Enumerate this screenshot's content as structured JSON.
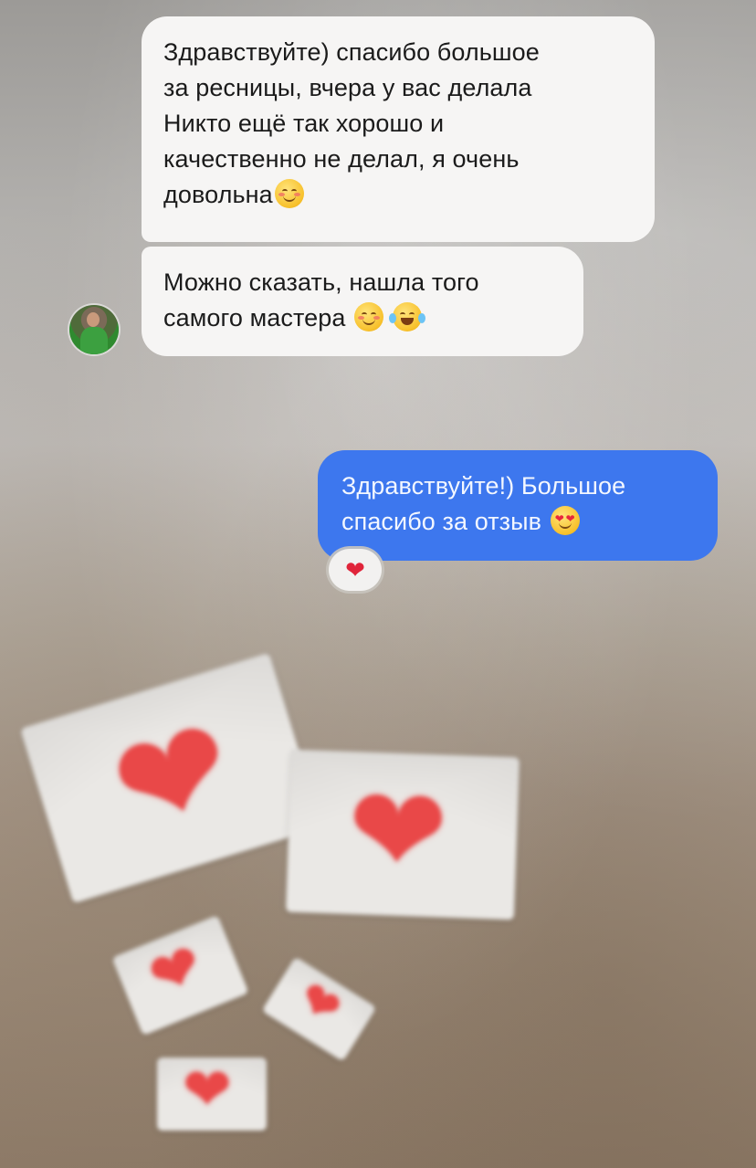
{
  "chat": {
    "incoming": [
      {
        "lines": [
          "Здравствуйте) спасибо большое",
          "за ресницы, вчера у вас делала",
          "Никто ещё так хорошо и",
          "качественно не делал, я очень",
          "довольна"
        ],
        "emoji": "relieved-smile-emoji"
      },
      {
        "lines": [
          "Можно сказать, нашла того",
          "самого мастера"
        ],
        "emojis": [
          "smiling-blush-emoji",
          "tears-of-joy-emoji"
        ]
      }
    ],
    "outgoing": {
      "lines": [
        "Здравствуйте!) Большое",
        "спасибо за отзыв"
      ],
      "emoji": "heart-eyes-emoji",
      "reaction": "❤"
    },
    "accent": "#3d77ee"
  },
  "decor": {
    "heart_glyph": "❤",
    "envelope_icon": "love-letter-icon"
  }
}
